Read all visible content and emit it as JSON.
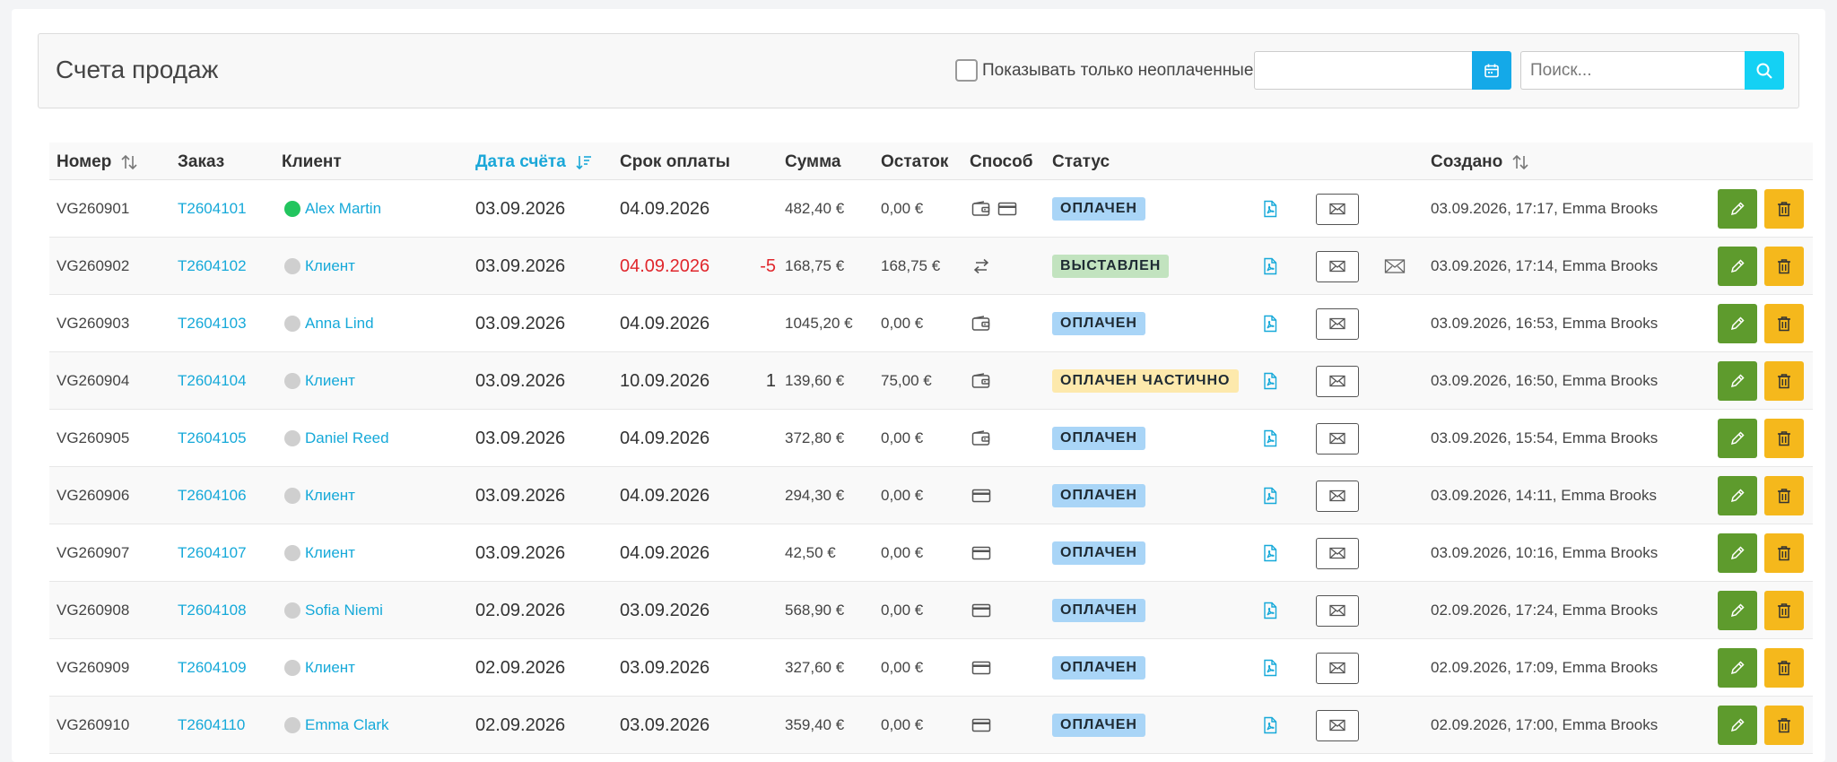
{
  "header": {
    "title": "Счета продаж",
    "unpaid_only_label": "Показывать только неоплаченные",
    "date_value": "",
    "search_placeholder": "Поиск..."
  },
  "columns": {
    "number": "Номер",
    "order": "Заказ",
    "client": "Клиент",
    "invoice_date": "Дата счёта",
    "due_date": "Срок оплаты",
    "amount": "Сумма",
    "balance": "Остаток",
    "method": "Способ",
    "status": "Статус",
    "created": "Создано"
  },
  "colors": {
    "accent": "#14a9e8",
    "paid_badge": "#a9d5f7",
    "issued_badge": "#c2e3bf",
    "partial_badge": "#fde9ac",
    "edit_button": "#5e9b2d",
    "delete_button": "#f5b81c",
    "client_online": "#22c55e",
    "client_offline": "#cfcfcf"
  },
  "rows": [
    {
      "number": "VG260901",
      "order": "T2604101",
      "client": "Alex Martin",
      "client_status": "online",
      "invoice_date": "03.09.2026",
      "due_date": "04.09.2026",
      "days": "",
      "overdue": false,
      "amount": "482,40 €",
      "balance": "0,00 €",
      "method_icons": [
        "wallet-icon",
        "credit-card-icon"
      ],
      "status": "ОПЛАЧЕН",
      "status_type": "paid",
      "sent_icon": false,
      "created": "03.09.2026, 17:17, Emma Brooks"
    },
    {
      "number": "VG260902",
      "order": "T2604102",
      "client": "Клиент",
      "client_status": "offline",
      "invoice_date": "03.09.2026",
      "due_date": "04.09.2026",
      "days": "-5",
      "overdue": true,
      "amount": "168,75 €",
      "balance": "168,75 €",
      "method_icons": [
        "transfer-icon"
      ],
      "status": "ВЫСТАВЛЕН",
      "status_type": "issued",
      "sent_icon": true,
      "created": "03.09.2026, 17:14, Emma Brooks"
    },
    {
      "number": "VG260903",
      "order": "T2604103",
      "client": "Anna Lind",
      "client_status": "offline",
      "invoice_date": "03.09.2026",
      "due_date": "04.09.2026",
      "days": "",
      "overdue": false,
      "amount": "1045,20 €",
      "balance": "0,00 €",
      "method_icons": [
        "wallet-icon"
      ],
      "status": "ОПЛАЧЕН",
      "status_type": "paid",
      "sent_icon": false,
      "created": "03.09.2026, 16:53, Emma Brooks"
    },
    {
      "number": "VG260904",
      "order": "T2604104",
      "client": "Клиент",
      "client_status": "offline",
      "invoice_date": "03.09.2026",
      "due_date": "10.09.2026",
      "days": "1",
      "overdue": false,
      "amount": "139,60 €",
      "balance": "75,00 €",
      "method_icons": [
        "wallet-icon"
      ],
      "status": "ОПЛАЧЕН ЧАСТИЧНО",
      "status_type": "partial",
      "sent_icon": false,
      "created": "03.09.2026, 16:50, Emma Brooks"
    },
    {
      "number": "VG260905",
      "order": "T2604105",
      "client": "Daniel Reed",
      "client_status": "offline",
      "invoice_date": "03.09.2026",
      "due_date": "04.09.2026",
      "days": "",
      "overdue": false,
      "amount": "372,80 €",
      "balance": "0,00 €",
      "method_icons": [
        "wallet-icon"
      ],
      "status": "ОПЛАЧЕН",
      "status_type": "paid",
      "sent_icon": false,
      "created": "03.09.2026, 15:54, Emma Brooks"
    },
    {
      "number": "VG260906",
      "order": "T2604106",
      "client": "Клиент",
      "client_status": "offline",
      "invoice_date": "03.09.2026",
      "due_date": "04.09.2026",
      "days": "",
      "overdue": false,
      "amount": "294,30 €",
      "balance": "0,00 €",
      "method_icons": [
        "credit-card-icon"
      ],
      "status": "ОПЛАЧЕН",
      "status_type": "paid",
      "sent_icon": false,
      "created": "03.09.2026, 14:11, Emma Brooks"
    },
    {
      "number": "VG260907",
      "order": "T2604107",
      "client": "Клиент",
      "client_status": "offline",
      "invoice_date": "03.09.2026",
      "due_date": "04.09.2026",
      "days": "",
      "overdue": false,
      "amount": "42,50 €",
      "balance": "0,00 €",
      "method_icons": [
        "credit-card-icon"
      ],
      "status": "ОПЛАЧЕН",
      "status_type": "paid",
      "sent_icon": false,
      "created": "03.09.2026, 10:16, Emma Brooks"
    },
    {
      "number": "VG260908",
      "order": "T2604108",
      "client": "Sofia Niemi",
      "client_status": "offline",
      "invoice_date": "02.09.2026",
      "due_date": "03.09.2026",
      "days": "",
      "overdue": false,
      "amount": "568,90 €",
      "balance": "0,00 €",
      "method_icons": [
        "credit-card-icon"
      ],
      "status": "ОПЛАЧЕН",
      "status_type": "paid",
      "sent_icon": false,
      "created": "02.09.2026, 17:24, Emma Brooks"
    },
    {
      "number": "VG260909",
      "order": "T2604109",
      "client": "Клиент",
      "client_status": "offline",
      "invoice_date": "02.09.2026",
      "due_date": "03.09.2026",
      "days": "",
      "overdue": false,
      "amount": "327,60 €",
      "balance": "0,00 €",
      "method_icons": [
        "credit-card-icon"
      ],
      "status": "ОПЛАЧЕН",
      "status_type": "paid",
      "sent_icon": false,
      "created": "02.09.2026, 17:09, Emma Brooks"
    },
    {
      "number": "VG260910",
      "order": "T2604110",
      "client": "Emma Clark",
      "client_status": "offline",
      "invoice_date": "02.09.2026",
      "due_date": "03.09.2026",
      "days": "",
      "overdue": false,
      "amount": "359,40 €",
      "balance": "0,00 €",
      "method_icons": [
        "credit-card-icon"
      ],
      "status": "ОПЛАЧЕН",
      "status_type": "paid",
      "sent_icon": false,
      "created": "02.09.2026, 17:00, Emma Brooks"
    }
  ]
}
